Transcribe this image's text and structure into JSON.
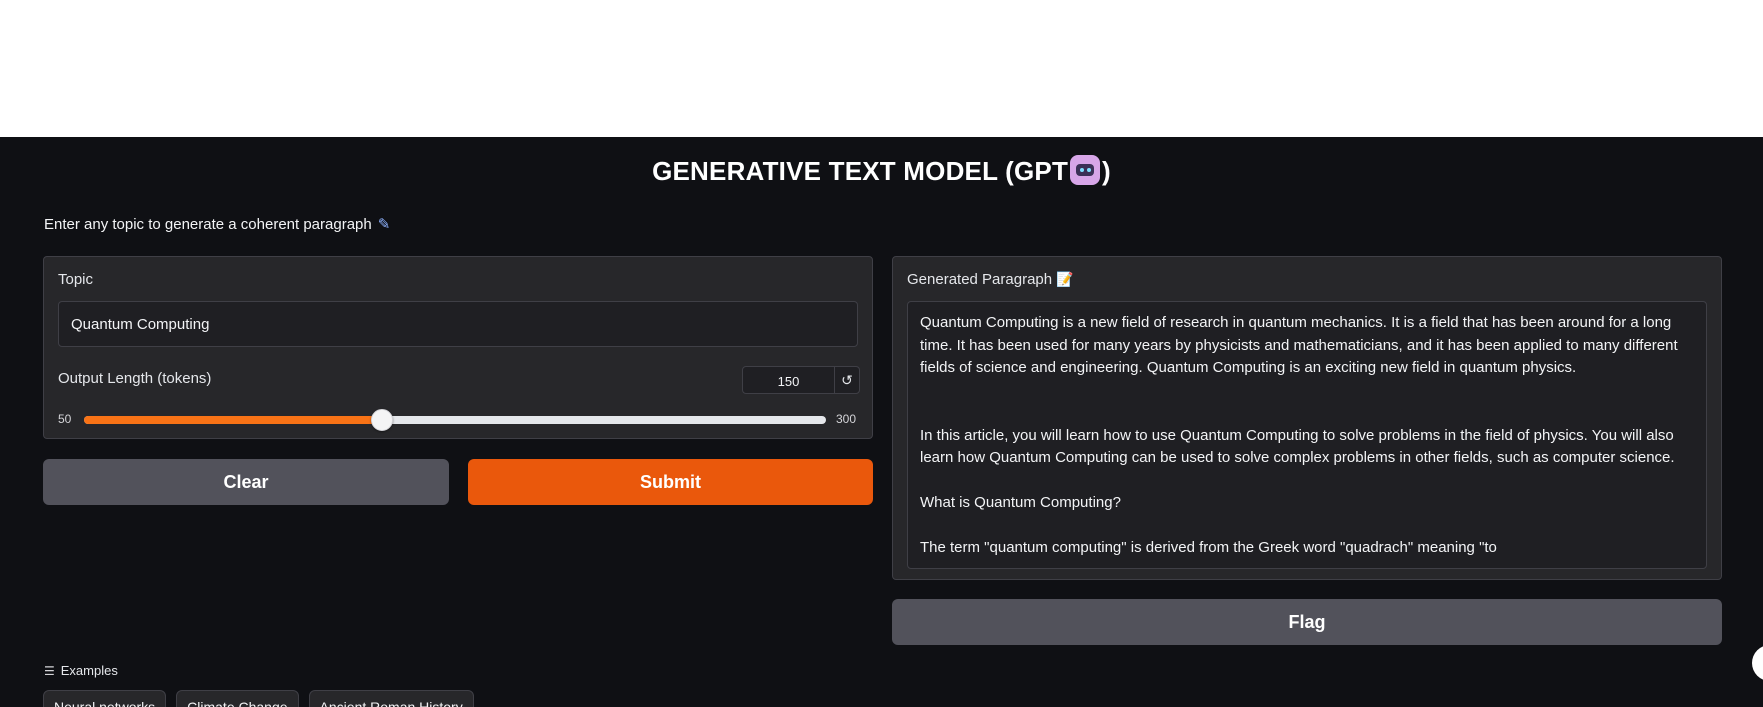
{
  "page": {
    "title_prefix": "GENERATIVE TEXT MODEL (GPT",
    "title_suffix": ")",
    "subtitle": "Enter any topic to generate a coherent paragraph"
  },
  "input_panel": {
    "topic_label": "Topic",
    "topic_value": "Quantum Computing",
    "length_label": "Output Length (tokens)",
    "length_value": "150",
    "length_min": "50",
    "length_max": "300",
    "length_fraction": 0.4,
    "reset_glyph": "↺"
  },
  "buttons": {
    "clear": "Clear",
    "submit": "Submit",
    "flag": "Flag"
  },
  "output_panel": {
    "label": "Generated Paragraph",
    "paragraphs": [
      "Quantum Computing is a new field of research in quantum mechanics. It is a field that has been around for a long time. It has been used for many years by physicists and mathematicians, and it has been applied to many different fields of science and engineering. Quantum Computing is an exciting new field in quantum physics.",
      "",
      "In this article, you will learn how to use Quantum Computing to solve problems in the field of physics. You will also learn how Quantum Computing can be used to solve complex problems in other fields, such as computer science.",
      "What is Quantum Computing?",
      "The term \"quantum computing\" is derived from the Greek word \"quadrach\" meaning \"to"
    ]
  },
  "examples": {
    "label": "Examples",
    "items": [
      "Neural networks",
      "Climate Change",
      "Ancient Roman History"
    ]
  },
  "icons": {
    "title_icon": "robot-icon",
    "subtitle_icon": "pencil-icon",
    "output_icon": "document-icon",
    "examples_icon": "list-icon"
  },
  "colors": {
    "accent": "#ea580c",
    "slider_fill": "#f97316",
    "background": "#0f1014",
    "panel": "#27272a",
    "secondary_button": "#52525b"
  }
}
